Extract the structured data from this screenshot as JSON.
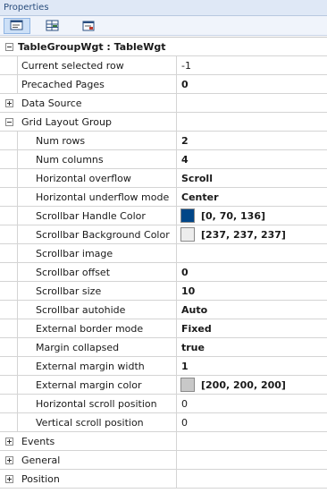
{
  "window": {
    "title": "Properties"
  },
  "toolbar": {
    "buttons": [
      {
        "name": "categorized-view-icon"
      },
      {
        "name": "alphabetical-view-icon"
      },
      {
        "name": "property-pages-icon"
      }
    ]
  },
  "grid": {
    "header": {
      "label": "TableGroupWgt : TableWgt",
      "expanded": true
    },
    "top_rows": [
      {
        "name": "Current selected row",
        "value": "-1"
      },
      {
        "name": "Precached Pages",
        "value": "0"
      }
    ],
    "data_source": {
      "label": "Data Source",
      "expanded": false
    },
    "grid_layout_group": {
      "label": "Grid Layout Group",
      "expanded": true,
      "rows": [
        {
          "name": "Num rows",
          "value": "2"
        },
        {
          "name": "Num columns",
          "value": "4"
        },
        {
          "name": "Horizontal overflow",
          "value": "Scroll"
        },
        {
          "name": "Horizontal underflow mode",
          "value": "Center"
        },
        {
          "name": "Scrollbar Handle Color",
          "value": "[0, 70, 136]",
          "color": "#004688"
        },
        {
          "name": "Scrollbar Background Color",
          "value": "[237, 237, 237]",
          "color": "#ededed"
        },
        {
          "name": "Scrollbar image",
          "value": ""
        },
        {
          "name": "Scrollbar offset",
          "value": "0"
        },
        {
          "name": "Scrollbar size",
          "value": "10"
        },
        {
          "name": "Scrollbar autohide",
          "value": "Auto"
        },
        {
          "name": "External border mode",
          "value": "Fixed"
        },
        {
          "name": "Margin collapsed",
          "value": "true"
        },
        {
          "name": "External margin width",
          "value": "1"
        },
        {
          "name": "External margin color",
          "value": "[200, 200, 200]",
          "color": "#c8c8c8"
        },
        {
          "name": "Horizontal scroll position",
          "value": "0"
        },
        {
          "name": "Vertical scroll position",
          "value": "0"
        }
      ]
    },
    "collapsed_groups": [
      {
        "label": "Events"
      },
      {
        "label": "General"
      },
      {
        "label": "Position"
      }
    ]
  }
}
